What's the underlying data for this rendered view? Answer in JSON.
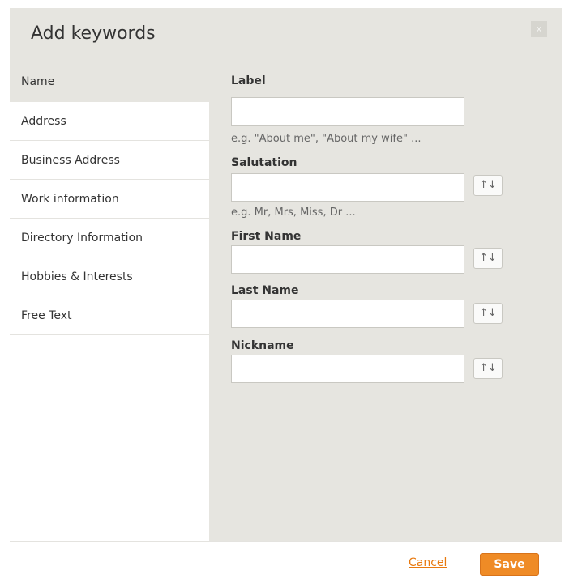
{
  "dialog": {
    "title": "Add keywords",
    "close_label": "x"
  },
  "sidebar": {
    "items": [
      {
        "label": "Name"
      },
      {
        "label": "Address"
      },
      {
        "label": "Business Address"
      },
      {
        "label": "Work information"
      },
      {
        "label": "Directory Information"
      },
      {
        "label": "Hobbies & Interests"
      },
      {
        "label": "Free Text"
      }
    ]
  },
  "form": {
    "label": {
      "title": "Label",
      "value": "",
      "hint": "e.g. \"About me\", \"About my wife\" ..."
    },
    "salutation": {
      "title": "Salutation",
      "value": "",
      "hint": "e.g. Mr, Mrs, Miss, Dr ..."
    },
    "first_name": {
      "title": "First Name",
      "value": ""
    },
    "last_name": {
      "title": "Last Name",
      "value": ""
    },
    "nickname": {
      "title": "Nickname",
      "value": ""
    },
    "sort_icon_glyph": "↑↓"
  },
  "footer": {
    "cancel_label": "Cancel",
    "save_label": "Save"
  },
  "colors": {
    "accent": "#ef8b26",
    "link": "#e8790f",
    "panel_bg": "#e6e5e0"
  }
}
